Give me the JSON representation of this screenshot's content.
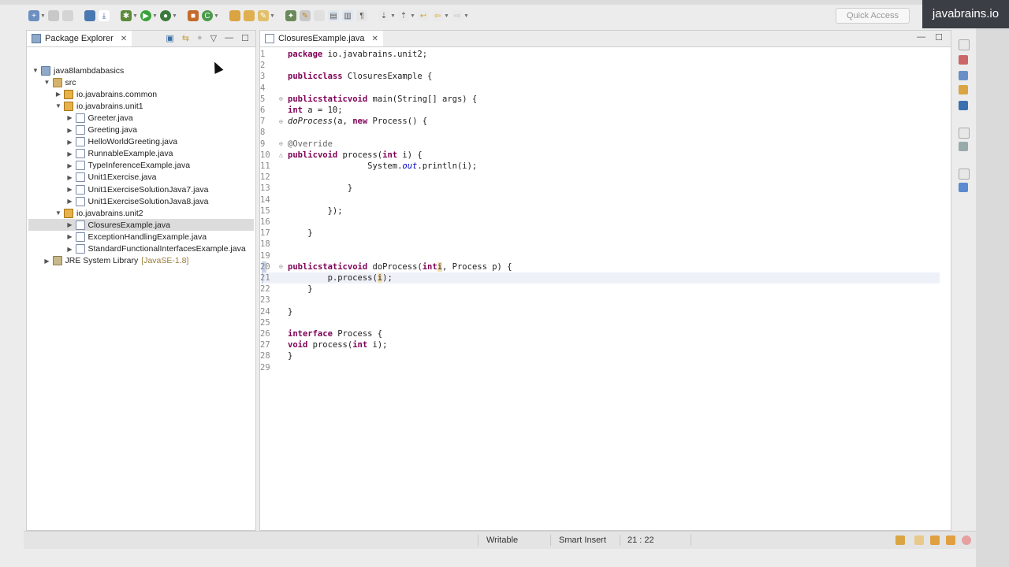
{
  "brand": "javabrains.io",
  "quick_access_placeholder": "Quick Access",
  "package_explorer": {
    "tab_label": "Package Explorer",
    "tree": [
      {
        "label": "java8lambdabasics",
        "level": 0,
        "expanded": true,
        "kind": "project"
      },
      {
        "label": "src",
        "level": 1,
        "expanded": true,
        "kind": "src"
      },
      {
        "label": "io.javabrains.common",
        "level": 2,
        "expanded": false,
        "kind": "package"
      },
      {
        "label": "io.javabrains.unit1",
        "level": 2,
        "expanded": true,
        "kind": "package"
      },
      {
        "label": "Greeter.java",
        "level": 3,
        "expanded": false,
        "kind": "java"
      },
      {
        "label": "Greeting.java",
        "level": 3,
        "expanded": false,
        "kind": "java"
      },
      {
        "label": "HelloWorldGreeting.java",
        "level": 3,
        "expanded": false,
        "kind": "java"
      },
      {
        "label": "RunnableExample.java",
        "level": 3,
        "expanded": false,
        "kind": "java"
      },
      {
        "label": "TypeInferenceExample.java",
        "level": 3,
        "expanded": false,
        "kind": "java"
      },
      {
        "label": "Unit1Exercise.java",
        "level": 3,
        "expanded": false,
        "kind": "java"
      },
      {
        "label": "Unit1ExerciseSolutionJava7.java",
        "level": 3,
        "expanded": false,
        "kind": "java"
      },
      {
        "label": "Unit1ExerciseSolutionJava8.java",
        "level": 3,
        "expanded": false,
        "kind": "java"
      },
      {
        "label": "io.javabrains.unit2",
        "level": 2,
        "expanded": true,
        "kind": "package"
      },
      {
        "label": "ClosuresExample.java",
        "level": 3,
        "expanded": false,
        "kind": "java",
        "selected": true
      },
      {
        "label": "ExceptionHandlingExample.java",
        "level": 3,
        "expanded": false,
        "kind": "java"
      },
      {
        "label": "StandardFunctionalInterfacesExample.java",
        "level": 3,
        "expanded": false,
        "kind": "java"
      },
      {
        "label": "JRE System Library",
        "level": 1,
        "expanded": false,
        "kind": "lib",
        "suffix": "[JavaSE-1.8]"
      }
    ]
  },
  "editor": {
    "tab_label": "ClosuresExample.java",
    "lines": [
      {
        "n": "1",
        "html": "<span class='kw'>package</span> io.javabrains.unit2;"
      },
      {
        "n": "2",
        "html": ""
      },
      {
        "n": "3",
        "html": "<span class='kw'>public</span> <span class='kw'>class</span> ClosuresExample {"
      },
      {
        "n": "4",
        "html": ""
      },
      {
        "n": "5",
        "fold": "⊖",
        "html": "    <span class='kw'>public</span> <span class='kw'>static</span> <span class='kw'>void</span> main(String[] args) {"
      },
      {
        "n": "6",
        "html": "        <span class='kw'>int</span> a = 10;"
      },
      {
        "n": "7",
        "fold": "⊖",
        "html": "        <span class='it'>doProcess</span>(a, <span class='kw'>new</span> Process() {"
      },
      {
        "n": "8",
        "html": ""
      },
      {
        "n": "9",
        "fold": "⊖",
        "html": "            <span class='ann'>@Override</span>"
      },
      {
        "n": "10",
        "fold": "△",
        "html": "            <span class='kw'>public</span> <span class='kw'>void</span> process(<span class='kw'>int</span> i) {"
      },
      {
        "n": "11",
        "html": "                System.<span class='fld'>out</span>.println(i);"
      },
      {
        "n": "12",
        "html": ""
      },
      {
        "n": "13",
        "html": "            }"
      },
      {
        "n": "14",
        "html": ""
      },
      {
        "n": "15",
        "html": "        });"
      },
      {
        "n": "16",
        "html": ""
      },
      {
        "n": "17",
        "html": "    }"
      },
      {
        "n": "18",
        "html": ""
      },
      {
        "n": "19",
        "html": ""
      },
      {
        "n": "20",
        "fold": "⊖",
        "html": "    <span class='kw'>public</span> <span class='kw'>static</span> <span class='kw'>void</span> doProcess(<span class='kw'>int</span> <span class='hl'>i</span>, Process p) {"
      },
      {
        "n": "21",
        "html": "        p.process(<span class='hl'>i</span>);",
        "current": true
      },
      {
        "n": "22",
        "html": "    }"
      },
      {
        "n": "23",
        "html": ""
      },
      {
        "n": "24",
        "html": "}"
      },
      {
        "n": "25",
        "html": ""
      },
      {
        "n": "26",
        "html": "<span class='kw'>interface</span> Process {"
      },
      {
        "n": "27",
        "html": "    <span class='kw'>void</span> process(<span class='kw'>int</span> i);"
      },
      {
        "n": "28",
        "html": "}"
      },
      {
        "n": "29",
        "html": ""
      }
    ]
  },
  "status": {
    "writable": "Writable",
    "insert_mode": "Smart Insert",
    "position": "21 : 22"
  }
}
